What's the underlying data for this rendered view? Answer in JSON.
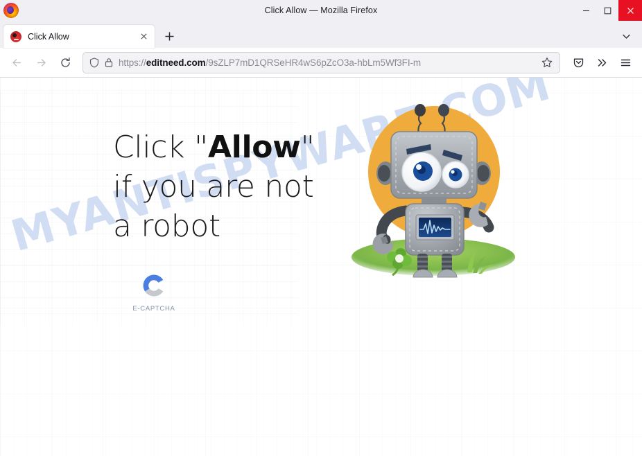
{
  "window": {
    "title": "Click Allow — Mozilla Firefox",
    "minimize_label": "Minimize",
    "maximize_label": "Maximize",
    "close_label": "Close",
    "logo_icon": "firefox-logo"
  },
  "tabbar": {
    "tabs": [
      {
        "title": "Click Allow",
        "favicon_icon": "site-favicon",
        "close_icon": "close-icon"
      }
    ],
    "new_tab_label": "+",
    "new_tab_icon": "plus-icon",
    "list_all_tabs_icon": "chevron-down-icon"
  },
  "toolbar": {
    "back_icon": "arrow-left-icon",
    "forward_icon": "arrow-right-icon",
    "reload_icon": "reload-icon",
    "shield_icon": "shield-icon",
    "lock_icon": "lock-icon",
    "bookmark_icon": "star-icon",
    "pocket_icon": "pocket-icon",
    "overflow_icon": "chevron-double-right-icon",
    "menu_icon": "hamburger-menu-icon",
    "url": {
      "scheme": "https://",
      "domain": "editneed.com",
      "path": "/9sZLP7mD1QRSeHR4wS6pZcO3a-hbLm5Wf3FI-m"
    }
  },
  "page": {
    "watermark": "MYANTISPYWARE.COM",
    "headline": {
      "part1": "Click \"",
      "emphasis": "Allow",
      "part2": "\" if you are not a robot"
    },
    "captcha": {
      "label": "E-CAPTCHA",
      "logo_icon": "e-captcha-c-logo",
      "colors": {
        "blue": "#4a7ee0",
        "gray": "#c5c9ce"
      }
    },
    "illustration": {
      "name": "robot-mascot-illustration",
      "colors": {
        "circle": "#efab3c",
        "body": "#9ea3a8",
        "screen": "#14356b",
        "grass": "#7ab648"
      }
    }
  }
}
